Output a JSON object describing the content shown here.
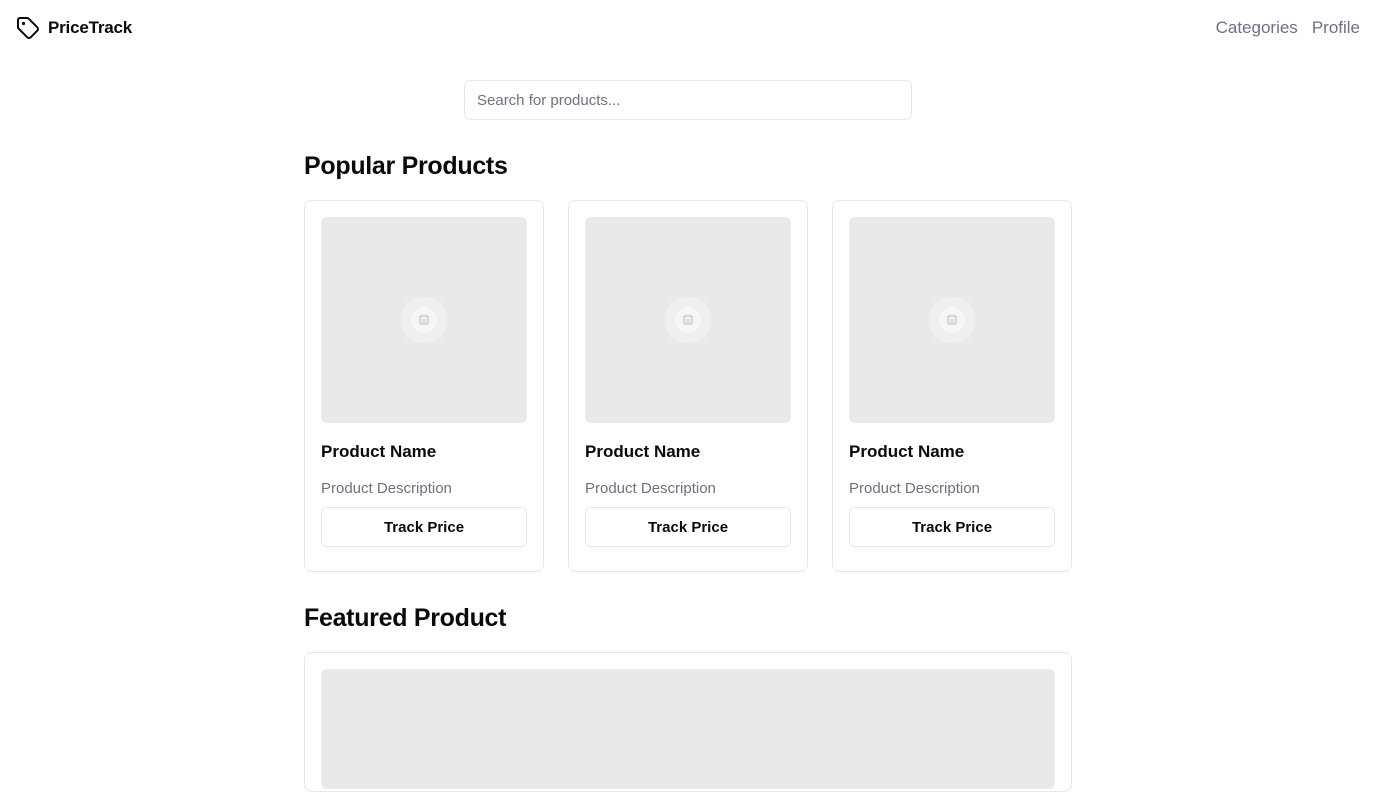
{
  "header": {
    "brand_name": "PriceTrack",
    "brand_icon": "tag-icon",
    "nav": [
      "Categories",
      "Profile"
    ]
  },
  "search": {
    "placeholder": "Search for products...",
    "value": ""
  },
  "popular": {
    "title": "Popular Products",
    "products": [
      {
        "name": "Product Name",
        "description": "Product Description",
        "button": "Track Price",
        "image_icon": "image-placeholder-icon"
      },
      {
        "name": "Product Name",
        "description": "Product Description",
        "button": "Track Price",
        "image_icon": "image-placeholder-icon"
      },
      {
        "name": "Product Name",
        "description": "Product Description",
        "button": "Track Price",
        "image_icon": "image-placeholder-icon"
      }
    ]
  },
  "featured": {
    "title": "Featured Product"
  },
  "colors": {
    "text": "#0a0a0a",
    "muted": "#6b7280",
    "border": "#e5e7eb",
    "placeholder_bg": "#e9e9e9"
  }
}
